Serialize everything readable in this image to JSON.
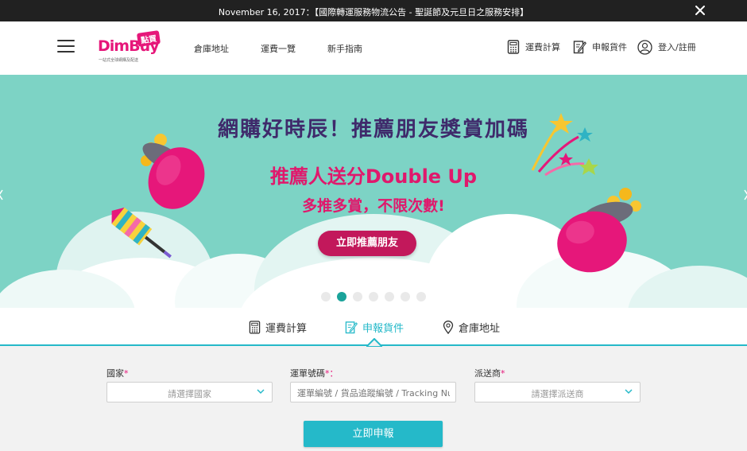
{
  "announcement": {
    "text": "November 16, 2017：【國際轉運服務物流公告 - 聖誕節及元旦日之服務安排】",
    "close_icon": "close-icon"
  },
  "header": {
    "logo": {
      "brand": "DimBuy",
      "badge": "點買",
      "tagline": "一站式全球網購及配送"
    },
    "nav": [
      "倉庫地址",
      "運費一覽",
      "新手指南"
    ],
    "tools": [
      {
        "label": "運費計算",
        "icon": "calculator-icon"
      },
      {
        "label": "申報貨件",
        "icon": "edit-form-icon"
      },
      {
        "label": "登入/註冊",
        "icon": "user-icon"
      }
    ]
  },
  "banner": {
    "title": "網購好時辰！推薦朋友獎賞加碼",
    "line1": "推薦人送分Double Up",
    "line2": "多推多賞，不限次數!",
    "cta": "立即推薦朋友",
    "slide_count": 7,
    "active_slide": 2
  },
  "tabs": [
    {
      "label": "運費計算",
      "icon": "calculator-icon",
      "active": false
    },
    {
      "label": "申報貨件",
      "icon": "edit-form-icon",
      "active": true
    },
    {
      "label": "倉庫地址",
      "icon": "location-pin-icon",
      "active": false
    }
  ],
  "form": {
    "country": {
      "label": "國家",
      "required_mark": "*",
      "value": "請選擇國家"
    },
    "tracking": {
      "label": "運單號碼",
      "required_mark": "*：",
      "placeholder": "運單編號 / 貨品追蹤編號 / Tracking Number"
    },
    "carrier": {
      "label": "派送商",
      "required_mark": "*",
      "value": "請選擇派送商"
    },
    "submit_label": "立即申報"
  },
  "colors": {
    "brand_pink": "#e6177a",
    "accent_teal": "#25b9c9",
    "banner_bg": "#7dd3c5",
    "cta": "#c2185b"
  }
}
